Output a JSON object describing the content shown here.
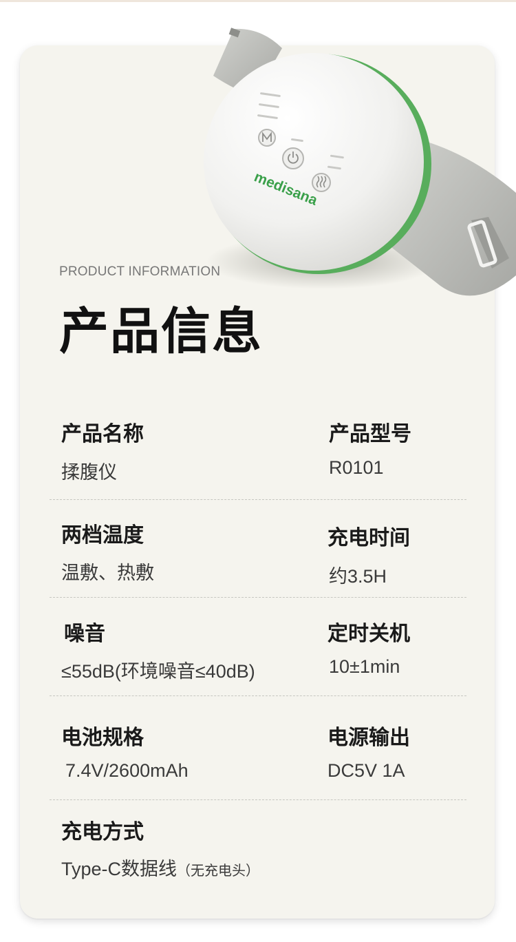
{
  "product": {
    "brand_logo": "medisana",
    "button_icons": [
      "mode-icon",
      "power-icon",
      "heat-icon"
    ]
  },
  "header": {
    "subtitle": "PRODUCT INFORMATION",
    "title": "产品信息"
  },
  "specs": [
    {
      "label": "产品名称",
      "value": "揉腹仪"
    },
    {
      "label": "产品型号",
      "value": "R0101"
    },
    {
      "label": "两档温度",
      "value": "温敷、热敷"
    },
    {
      "label": "充电时间",
      "value": "约3.5H"
    },
    {
      "label": "噪音",
      "value": "≤55dB(环境噪音≤40dB)"
    },
    {
      "label": "定时关机",
      "value": "10±1min"
    },
    {
      "label": "电池规格",
      "value": "7.4V/2600mAh"
    },
    {
      "label": "电源输出",
      "value": "DC5V 1A"
    },
    {
      "label": "充电方式",
      "value": "Type-C数据线",
      "note": "（无充电头）"
    }
  ],
  "colors": {
    "card_bg": "#f5f4ee",
    "brand_green": "#3aa04a",
    "device_white": "#f7f7f5",
    "strap_gray": "#b9bab6"
  }
}
